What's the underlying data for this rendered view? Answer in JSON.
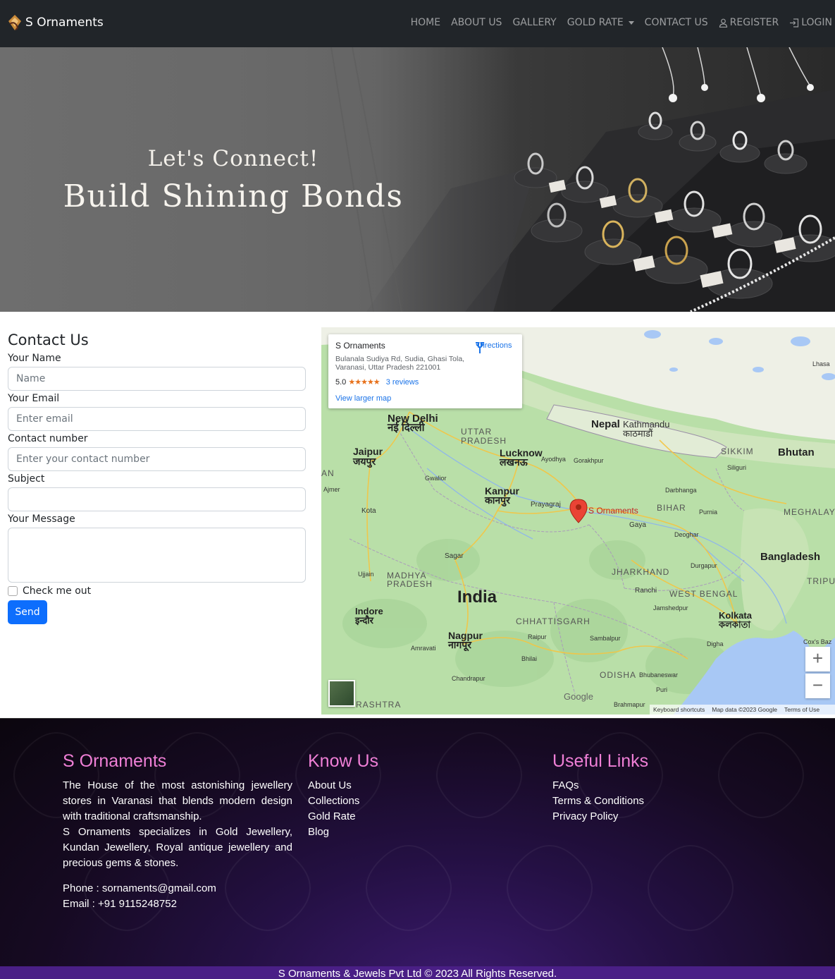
{
  "navbar": {
    "brand": "S Ornaments",
    "brand_logo": "diamond-logo-icon",
    "links": {
      "home": "HOME",
      "about": "ABOUT US",
      "gallery": "GALLERY",
      "gold_rate": "GOLD RATE",
      "contact": "CONTACT US",
      "register": "REGISTER",
      "login": "LOGIN"
    }
  },
  "hero": {
    "subtitle": "Let's Connect!",
    "title": "Build Shining Bonds"
  },
  "contact": {
    "heading": "Contact Us",
    "name_label": "Your Name",
    "name_placeholder": "Name",
    "email_label": "Your Email",
    "email_placeholder": "Enter email",
    "phone_label": "Contact number",
    "phone_placeholder": "Enter your contact number",
    "subject_label": "Subject",
    "subject_placeholder": "",
    "message_label": "Your Message",
    "check_label": "Check me out",
    "send_label": "Send"
  },
  "map": {
    "card": {
      "title": "S Ornaments",
      "address": "Bulanala Sudiya Rd, Sudia, Ghasi Tola, Varanasi, Uttar Pradesh 221001",
      "rating": "5.0",
      "stars": "★★★★★",
      "reviews": "3 reviews",
      "larger_map": "View larger map",
      "directions": "Directions"
    },
    "labels": {
      "new_delhi": "New Delhi",
      "new_delhi_hi": "नई दिल्ली",
      "uttar_pradesh": "UTTAR\nPRADESH",
      "nepal": "Nepal",
      "kathmandu": "Kathmandu",
      "kathmandu_hi": "काठमाडौं",
      "jaipur": "Jaipur",
      "jaipur_hi": "जयपुर",
      "lucknow": "Lucknow",
      "lucknow_hi": "लखनऊ",
      "sikkim": "SIKKIM",
      "bhutan": "Bhutan",
      "kanpur": "Kanpur",
      "kanpur_hi": "कानपुर",
      "prayagraj": "Prayagraj",
      "s_ornaments": "S Ornaments",
      "bihar": "BIHAR",
      "meghalaya": "MEGHALAY",
      "bangladesh": "Bangladesh",
      "madhya_pradesh": "MADHYA\nPRADESH",
      "india": "India",
      "jharkhand": "JHARKHAND",
      "west_bengal": "WEST BENGAL",
      "kolkata": "Kolkata",
      "kolkata_hi": "কলকাতা",
      "chhattisgarh": "CHHATTISGARH",
      "nagpur": "Nagpur",
      "nagpur_hi": "नागपूर",
      "indore": "Indore",
      "indore_hi": "इन्दौर",
      "odisha": "ODISHA",
      "bhubaneswar": "Bhubaneswar",
      "maharashtra": "RASHTRA",
      "gaya": "Gaya",
      "ranchi": "Ranchi",
      "sagar": "Sagar",
      "kota": "Kota",
      "gwalior": "Gwalior",
      "ayodhya": "Ayodhya",
      "gorakhpur": "Gorakhpur",
      "darbhanga": "Darbhanga",
      "purnia": "Purnia",
      "ujjain": "Ujjain",
      "raipur": "Raipur",
      "bhilai": "Bhilai",
      "amravati": "Amravati",
      "chandrapur": "Chandrapur",
      "jamshedpur": "Jamshedpur",
      "durgapur": "Durgapur",
      "deoghar": "Deoghar",
      "sambalpur": "Sambalpur",
      "puri": "Puri",
      "brahmapur": "Brahmapur",
      "digha": "Digha",
      "lhasa": "Lhasa",
      "siliguri": "Siliguri",
      "ajmer": "Ajmer",
      "coxs_bazar": "Cox's Baz",
      "tripura": "TRIPU",
      "an": "AN"
    },
    "zoom_in": "+",
    "zoom_out": "−",
    "google": "Google",
    "footer": {
      "shortcuts": "Keyboard shortcuts",
      "data": "Map data ©2023 Google",
      "terms": "Terms of Use"
    }
  },
  "footer": {
    "col1": {
      "heading": "S Ornaments",
      "para1": "The House of the most astonishing jewellery stores in Varanasi that blends modern design with traditional craftsmanship.",
      "para2": "S Ornaments specializes in Gold Jewellery, Kundan Jewellery, Royal antique jewellery and precious gems & stones.",
      "phone": "Phone : sornaments@gmail.com",
      "email": "Email : +91 9115248752"
    },
    "col2": {
      "heading": "Know Us",
      "links": [
        "About Us",
        "Collections",
        "Gold Rate",
        "Blog"
      ]
    },
    "col3": {
      "heading": "Useful Links",
      "links": [
        "FAQs",
        "Terms & Conditions",
        "Privacy Policy"
      ]
    },
    "copyright": "S Ornaments & Jewels Pvt Ltd © 2023 All Rights Reserved."
  }
}
